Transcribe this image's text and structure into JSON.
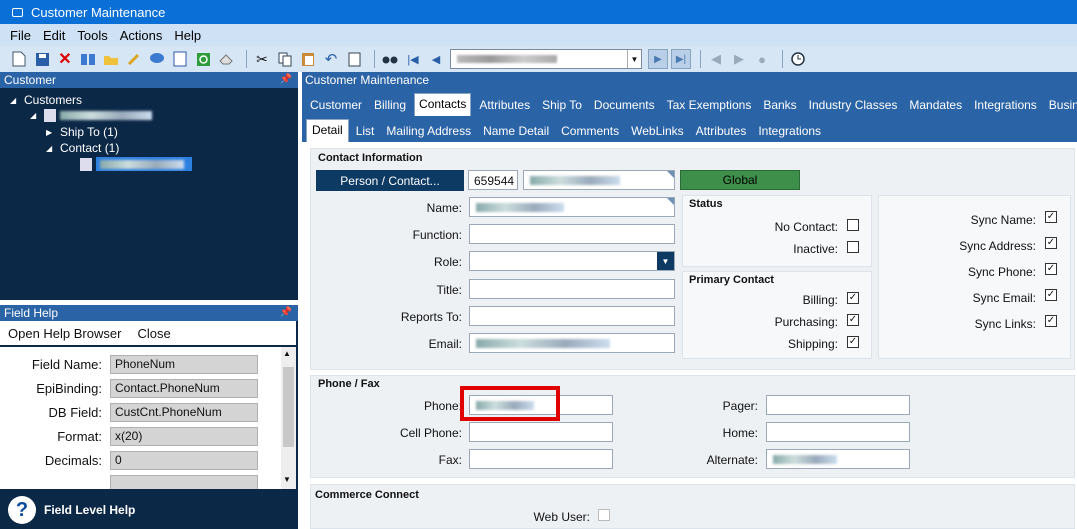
{
  "window": {
    "title": "Customer Maintenance"
  },
  "menu": [
    "File",
    "Edit",
    "Tools",
    "Actions",
    "Help"
  ],
  "left": {
    "customer_panel_title": "Customer",
    "tree": {
      "root": "Customers",
      "ship_to": "Ship To (1)",
      "contact": "Contact (1)"
    },
    "help_panel_title": "Field Help",
    "help_tools": {
      "open": "Open Help Browser",
      "close": "Close"
    },
    "help_fields": [
      {
        "label": "Field Name:",
        "value": "PhoneNum"
      },
      {
        "label": "EpiBinding:",
        "value": "Contact.PhoneNum"
      },
      {
        "label": "DB Field:",
        "value": "CustCnt.PhoneNum"
      },
      {
        "label": "Format:",
        "value": "x(20)"
      },
      {
        "label": "Decimals:",
        "value": "0"
      }
    ],
    "help_footer": "Field Level Help"
  },
  "main": {
    "header": "Customer Maintenance",
    "tabs": [
      "Customer",
      "Billing",
      "Contacts",
      "Attributes",
      "Ship To",
      "Documents",
      "Tax Exemptions",
      "Banks",
      "Industry Classes",
      "Mandates",
      "Integrations",
      "Business"
    ],
    "active_tab": "Contacts",
    "subtabs": [
      "Detail",
      "List",
      "Mailing Address",
      "Name Detail",
      "Comments",
      "WebLinks",
      "Attributes",
      "Integrations"
    ],
    "active_subtab": "Detail",
    "contact_info": {
      "title": "Contact Information",
      "person_button": "Person / Contact...",
      "contact_id": "659544",
      "global_button": "Global",
      "labels": {
        "name": "Name:",
        "function": "Function:",
        "role": "Role:",
        "title": "Title:",
        "reports_to": "Reports To:",
        "email": "Email:"
      }
    },
    "status": {
      "title": "Status",
      "no_contact": "No Contact:",
      "inactive": "Inactive:"
    },
    "primary_contact": {
      "title": "Primary Contact",
      "billing": "Billing:",
      "purchasing": "Purchasing:",
      "shipping": "Shipping:"
    },
    "sync": {
      "name": "Sync Name:",
      "address": "Sync Address:",
      "phone": "Sync Phone:",
      "email": "Sync Email:",
      "links": "Sync Links:"
    },
    "phone_fax": {
      "title": "Phone / Fax",
      "phone": "Phone:",
      "cell": "Cell Phone:",
      "fax": "Fax:",
      "pager": "Pager:",
      "home": "Home:",
      "alternate": "Alternate:"
    },
    "commerce": {
      "title": "Commerce Connect",
      "web_user": "Web User:"
    }
  }
}
